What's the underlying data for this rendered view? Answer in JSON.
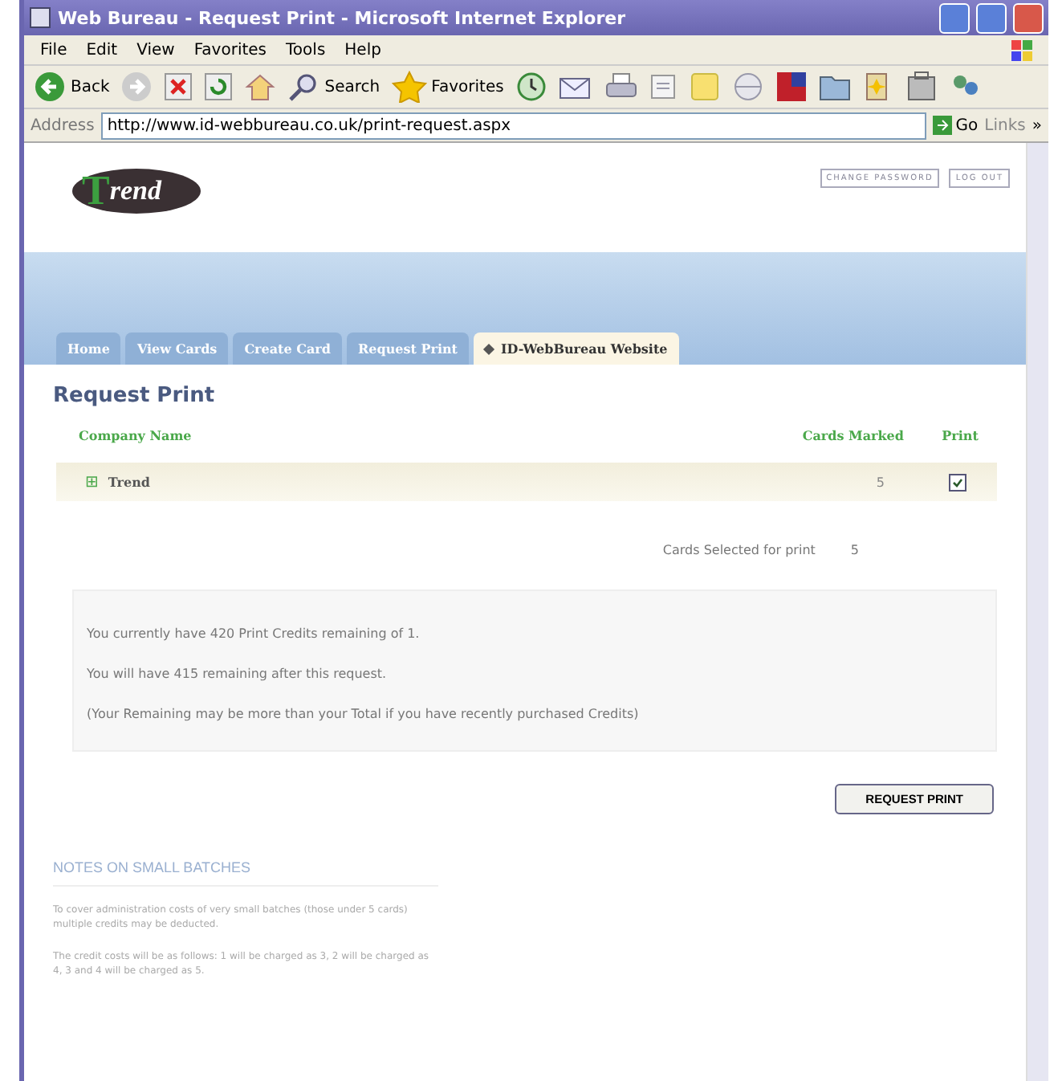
{
  "window": {
    "title": "Web Bureau - Request Print - Microsoft Internet Explorer"
  },
  "menu": [
    "File",
    "Edit",
    "View",
    "Favorites",
    "Tools",
    "Help"
  ],
  "toolbar": [
    {
      "kind": "back",
      "label": "Back"
    },
    {
      "kind": "forward"
    },
    {
      "kind": "stop"
    },
    {
      "kind": "refresh"
    },
    {
      "kind": "home"
    },
    {
      "kind": "search",
      "label": "Search"
    },
    {
      "kind": "favorites",
      "label": "Favorites"
    },
    {
      "kind": "history"
    },
    {
      "kind": "mail"
    },
    {
      "kind": "print"
    },
    {
      "kind": "edit"
    },
    {
      "kind": "note"
    },
    {
      "kind": "messenger"
    },
    {
      "kind": "media"
    },
    {
      "kind": "folder"
    },
    {
      "kind": "research"
    },
    {
      "kind": "tools"
    },
    {
      "kind": "people"
    }
  ],
  "address": {
    "label": "Address",
    "url": "http://www.id-webbureau.co.uk/print-request.aspx",
    "go": "Go",
    "links": "Links",
    "more": "»"
  },
  "logo": {
    "initial": "T",
    "rest": "rend"
  },
  "top_links": [
    "CHANGE PASSWORD",
    "LOG OUT"
  ],
  "tabs": [
    {
      "label": "Home",
      "selected": false
    },
    {
      "label": "View Cards",
      "selected": false
    },
    {
      "label": "Create Card",
      "selected": false
    },
    {
      "label": "Request Print",
      "selected": false
    },
    {
      "label": "ID-WebBureau Website",
      "selected": true
    }
  ],
  "heading": "Request Print",
  "table": {
    "columns": [
      "Company Name",
      "Cards Marked",
      "Print"
    ],
    "rows": [
      {
        "expand": "⊞",
        "company": "Trend",
        "cards": "5",
        "checked": true
      }
    ]
  },
  "selected_label": "Cards Selected for print",
  "selected_value": "5",
  "credits": [
    "You currently have 420 Print Credits remaining of 1.",
    "You will have 415 remaining after this request.",
    "(Your Remaining may be more than your Total if you have recently purchased Credits)"
  ],
  "button": "REQUEST PRINT",
  "notes": {
    "title": "NOTES ON SMALL BATCHES",
    "paragraphs": [
      "To cover administration costs of very small batches (those under 5 cards) multiple credits may be deducted.",
      "The credit costs will be as follows: 1 will be charged as 3, 2 will be charged as 4, 3 and 4 will be charged as 5."
    ]
  }
}
